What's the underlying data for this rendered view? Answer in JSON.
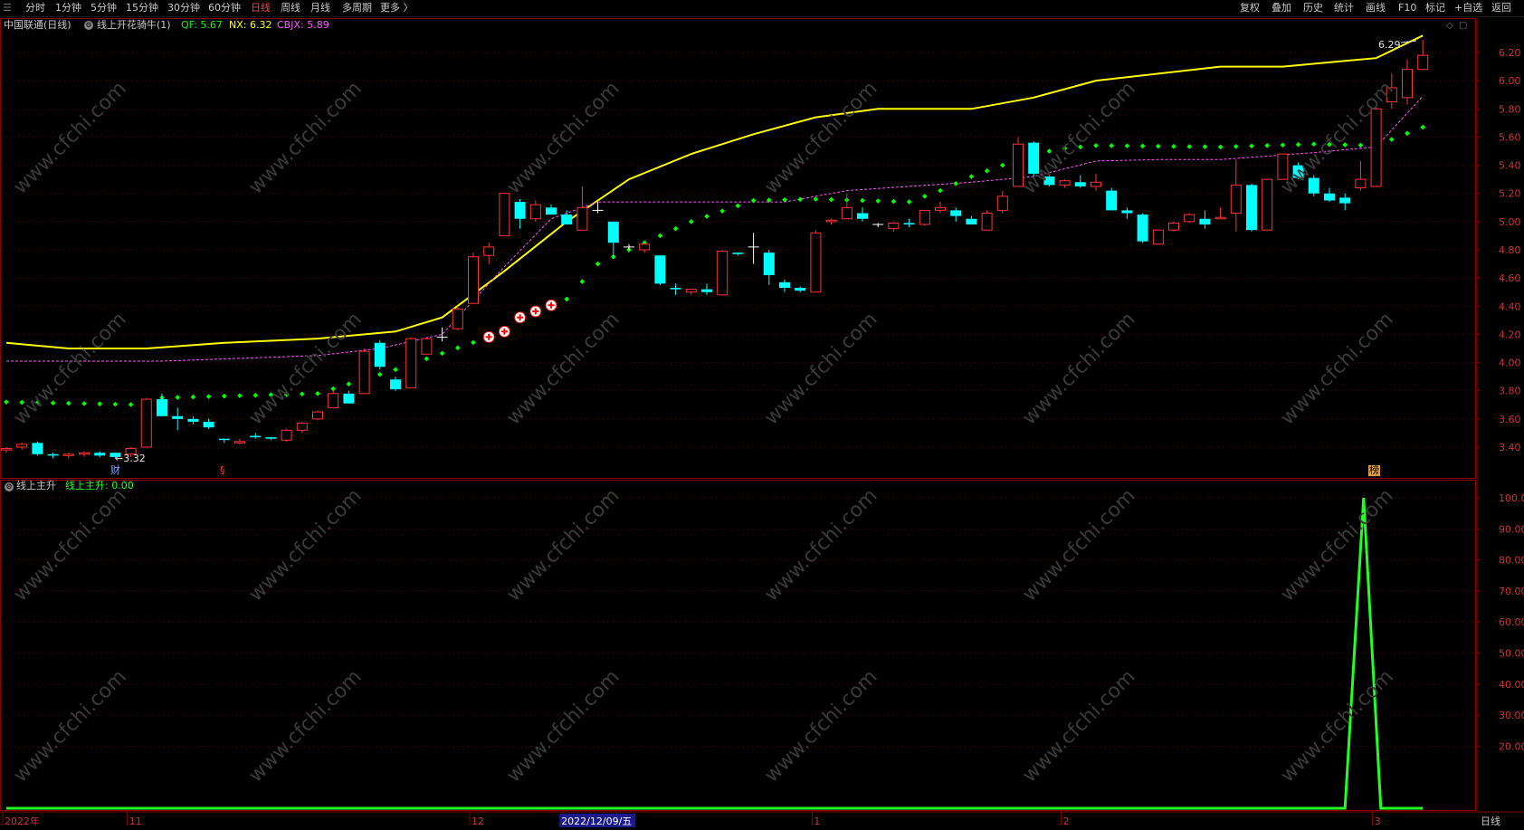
{
  "toolbar": {
    "periods": [
      "分时",
      "1分钟",
      "5分钟",
      "15分钟",
      "30分钟",
      "60分钟",
      "日线",
      "周线",
      "月线",
      "多周期",
      "更多 〉"
    ],
    "active_period": "日线",
    "right": [
      "复权",
      "叠加",
      "历史",
      "统计",
      "画线",
      "F10",
      "标记",
      "+自选",
      "返回"
    ]
  },
  "main_panel": {
    "stock_title": "中国联通(日线)",
    "indicator_name": "线上开花骑牛(1)",
    "qf_text": "QF: 5.67",
    "nx_text": "NX: 6.32",
    "cbjx_text": "CBJX: 5.89",
    "high_label": "6.29",
    "low_label": "←3.32",
    "event_marks": [
      "财",
      "§",
      "榜"
    ],
    "colors": {
      "qf": "#00ff00",
      "nx": "#ffff00",
      "cbjx": "#ff55ff",
      "up": "#ff3333",
      "down": "#00ffff"
    }
  },
  "sub_panel": {
    "indicator_name": "线上主升",
    "value_text": "线上主升: 0.00",
    "colors": {
      "line": "#22ff22"
    }
  },
  "y_axis_main": [
    "6.20",
    "6.00",
    "5.80",
    "5.60",
    "5.40",
    "5.20",
    "5.00",
    "4.80",
    "4.60",
    "4.40",
    "4.20",
    "4.00",
    "3.80",
    "3.60",
    "3.40"
  ],
  "y_axis_sub": [
    "100.0",
    "90.00",
    "80.00",
    "70.00",
    "60.00",
    "50.00",
    "40.00",
    "30.00",
    "20.00"
  ],
  "x_axis": [
    "2022年",
    "11",
    "12",
    "2022/12/09/五",
    "1",
    "2",
    "3"
  ],
  "period_label": "日线",
  "watermark": "www.cfchi.com",
  "chart_data": {
    "type": "candlestick",
    "ylim_main": [
      3.3,
      6.3
    ],
    "ylim_sub": [
      0,
      105
    ],
    "candles": [
      [
        3.38,
        3.4,
        3.36,
        3.39
      ],
      [
        3.4,
        3.43,
        3.38,
        3.42
      ],
      [
        3.43,
        3.44,
        3.34,
        3.35
      ],
      [
        3.35,
        3.36,
        3.32,
        3.34
      ],
      [
        3.34,
        3.36,
        3.32,
        3.35
      ],
      [
        3.35,
        3.37,
        3.33,
        3.36
      ],
      [
        3.36,
        3.37,
        3.33,
        3.34
      ],
      [
        3.36,
        3.36,
        3.32,
        3.33
      ],
      [
        3.35,
        3.4,
        3.33,
        3.39
      ],
      [
        3.4,
        3.75,
        3.4,
        3.74
      ],
      [
        3.74,
        3.78,
        3.62,
        3.62
      ],
      [
        3.62,
        3.68,
        3.52,
        3.6
      ],
      [
        3.6,
        3.62,
        3.56,
        3.58
      ],
      [
        3.58,
        3.6,
        3.53,
        3.54
      ],
      [
        3.46,
        3.46,
        3.43,
        3.45
      ],
      [
        3.43,
        3.46,
        3.42,
        3.44
      ],
      [
        3.48,
        3.5,
        3.46,
        3.47
      ],
      [
        3.47,
        3.47,
        3.45,
        3.46
      ],
      [
        3.45,
        3.53,
        3.44,
        3.52
      ],
      [
        3.52,
        3.58,
        3.5,
        3.57
      ],
      [
        3.6,
        3.66,
        3.59,
        3.65
      ],
      [
        3.68,
        3.8,
        3.68,
        3.78
      ],
      [
        3.78,
        3.8,
        3.71,
        3.71
      ],
      [
        3.78,
        4.1,
        3.78,
        4.08
      ],
      [
        4.14,
        4.16,
        3.95,
        3.97
      ],
      [
        3.88,
        3.9,
        3.8,
        3.81
      ],
      [
        3.82,
        4.18,
        3.82,
        4.17
      ],
      [
        4.06,
        4.18,
        4.06,
        4.17
      ],
      [
        4.18,
        4.25,
        4.15,
        4.18
      ],
      [
        4.24,
        4.4,
        4.23,
        4.38
      ],
      [
        4.42,
        4.78,
        4.42,
        4.75
      ],
      [
        4.76,
        4.85,
        4.7,
        4.82
      ],
      [
        4.9,
        5.2,
        4.9,
        5.2
      ],
      [
        5.14,
        5.16,
        4.95,
        5.02
      ],
      [
        5.02,
        5.15,
        5.0,
        5.12
      ],
      [
        5.1,
        5.12,
        5.05,
        5.05
      ],
      [
        5.05,
        5.08,
        4.98,
        4.98
      ],
      [
        4.94,
        5.25,
        4.94,
        5.1
      ],
      [
        5.08,
        5.14,
        5.06,
        5.08
      ],
      [
        5.0,
        5.0,
        4.75,
        4.85
      ],
      [
        4.82,
        4.84,
        4.8,
        4.82
      ],
      [
        4.8,
        4.85,
        4.78,
        4.84
      ],
      [
        4.76,
        4.76,
        4.55,
        4.56
      ],
      [
        4.53,
        4.56,
        4.48,
        4.52
      ],
      [
        4.5,
        4.52,
        4.48,
        4.52
      ],
      [
        4.52,
        4.56,
        4.48,
        4.5
      ],
      [
        4.48,
        4.8,
        4.48,
        4.79
      ],
      [
        4.78,
        4.78,
        4.76,
        4.77
      ],
      [
        4.82,
        4.92,
        4.7,
        4.82
      ],
      [
        4.78,
        4.8,
        4.55,
        4.62
      ],
      [
        4.57,
        4.59,
        4.5,
        4.53
      ],
      [
        4.53,
        4.54,
        4.5,
        4.51
      ],
      [
        4.5,
        4.94,
        4.5,
        4.92
      ],
      [
        5.0,
        5.02,
        4.98,
        5.01
      ],
      [
        5.02,
        5.2,
        5.02,
        5.1
      ],
      [
        5.06,
        5.1,
        5.0,
        5.02
      ],
      [
        4.98,
        4.99,
        4.96,
        4.98
      ],
      [
        4.95,
        5.0,
        4.93,
        4.99
      ],
      [
        4.99,
        5.02,
        4.96,
        4.98
      ],
      [
        4.98,
        5.08,
        4.97,
        5.08
      ],
      [
        5.08,
        5.14,
        5.06,
        5.1
      ],
      [
        5.08,
        5.1,
        5.0,
        5.04
      ],
      [
        5.02,
        5.04,
        4.98,
        4.98
      ],
      [
        4.94,
        5.08,
        4.94,
        5.06
      ],
      [
        5.08,
        5.22,
        5.06,
        5.18
      ],
      [
        5.25,
        5.6,
        5.25,
        5.55
      ],
      [
        5.56,
        5.57,
        5.32,
        5.34
      ],
      [
        5.32,
        5.35,
        5.25,
        5.26
      ],
      [
        5.26,
        5.3,
        5.24,
        5.29
      ],
      [
        5.28,
        5.33,
        5.24,
        5.25
      ],
      [
        5.25,
        5.34,
        5.22,
        5.28
      ],
      [
        5.22,
        5.24,
        5.08,
        5.08
      ],
      [
        5.08,
        5.1,
        5.02,
        5.06
      ],
      [
        5.05,
        5.06,
        4.85,
        4.86
      ],
      [
        4.84,
        4.94,
        4.84,
        4.94
      ],
      [
        4.94,
        5.0,
        4.93,
        4.99
      ],
      [
        5.0,
        5.06,
        4.99,
        5.05
      ],
      [
        5.02,
        5.08,
        4.95,
        4.98
      ],
      [
        5.02,
        5.1,
        5.02,
        5.03
      ],
      [
        5.06,
        5.44,
        4.93,
        5.26
      ],
      [
        5.26,
        5.27,
        4.93,
        4.94
      ],
      [
        4.94,
        5.3,
        4.94,
        5.3
      ],
      [
        5.3,
        5.48,
        5.3,
        5.48
      ],
      [
        5.4,
        5.42,
        5.3,
        5.31
      ],
      [
        5.31,
        5.33,
        5.18,
        5.2
      ],
      [
        5.2,
        5.24,
        5.14,
        5.15
      ],
      [
        5.17,
        5.2,
        5.08,
        5.13
      ],
      [
        5.24,
        5.43,
        5.22,
        5.3
      ],
      [
        5.25,
        5.81,
        5.25,
        5.8
      ],
      [
        5.85,
        6.05,
        5.8,
        5.95
      ],
      [
        5.88,
        6.15,
        5.83,
        6.08
      ],
      [
        6.08,
        6.29,
        6.1,
        6.18
      ]
    ],
    "nx": [
      [
        0,
        4.14
      ],
      [
        4,
        4.1
      ],
      [
        9,
        4.1
      ],
      [
        14,
        4.14
      ],
      [
        20,
        4.17
      ],
      [
        25,
        4.22
      ],
      [
        28,
        4.32
      ],
      [
        32,
        4.65
      ],
      [
        36,
        5.0
      ],
      [
        40,
        5.3
      ],
      [
        44,
        5.48
      ],
      [
        48,
        5.62
      ],
      [
        52,
        5.74
      ],
      [
        56,
        5.8
      ],
      [
        62,
        5.8
      ],
      [
        66,
        5.88
      ],
      [
        70,
        6.0
      ],
      [
        74,
        6.05
      ],
      [
        78,
        6.1
      ],
      [
        82,
        6.1
      ],
      [
        86,
        6.14
      ],
      [
        88,
        6.16
      ],
      [
        91,
        6.32
      ]
    ],
    "cbjx": [
      [
        0,
        4.01
      ],
      [
        10,
        4.01
      ],
      [
        20,
        4.05
      ],
      [
        24,
        4.1
      ],
      [
        28,
        4.2
      ],
      [
        32,
        4.68
      ],
      [
        35,
        5.02
      ],
      [
        38,
        5.14
      ],
      [
        44,
        5.14
      ],
      [
        50,
        5.14
      ],
      [
        54,
        5.22
      ],
      [
        58,
        5.25
      ],
      [
        62,
        5.28
      ],
      [
        66,
        5.32
      ],
      [
        70,
        5.43
      ],
      [
        74,
        5.44
      ],
      [
        78,
        5.44
      ],
      [
        84,
        5.49
      ],
      [
        88,
        5.53
      ],
      [
        91,
        5.89
      ]
    ],
    "qf": [
      [
        0,
        3.72
      ],
      [
        9,
        3.7
      ],
      [
        10,
        3.75
      ],
      [
        20,
        3.78
      ],
      [
        25,
        3.95
      ],
      [
        32,
        4.22
      ],
      [
        33,
        4.32
      ],
      [
        36,
        4.45
      ],
      [
        38,
        4.7
      ],
      [
        40,
        4.8
      ],
      [
        44,
        5.0
      ],
      [
        48,
        5.15
      ],
      [
        52,
        5.16
      ],
      [
        58,
        5.14
      ],
      [
        60,
        5.22
      ],
      [
        62,
        5.32
      ],
      [
        66,
        5.48
      ],
      [
        68,
        5.52
      ],
      [
        70,
        5.54
      ],
      [
        78,
        5.53
      ],
      [
        84,
        5.55
      ],
      [
        88,
        5.54
      ],
      [
        91,
        5.67
      ]
    ],
    "signal_idx": [
      31,
      32,
      33,
      34,
      35
    ],
    "sub_line": [
      [
        0,
        0
      ],
      [
        86,
        0
      ],
      [
        87.2,
        100
      ],
      [
        88.3,
        0
      ],
      [
        91,
        0
      ]
    ],
    "x_label_idx": [
      0,
      8,
      30,
      36,
      52,
      68,
      88
    ]
  }
}
